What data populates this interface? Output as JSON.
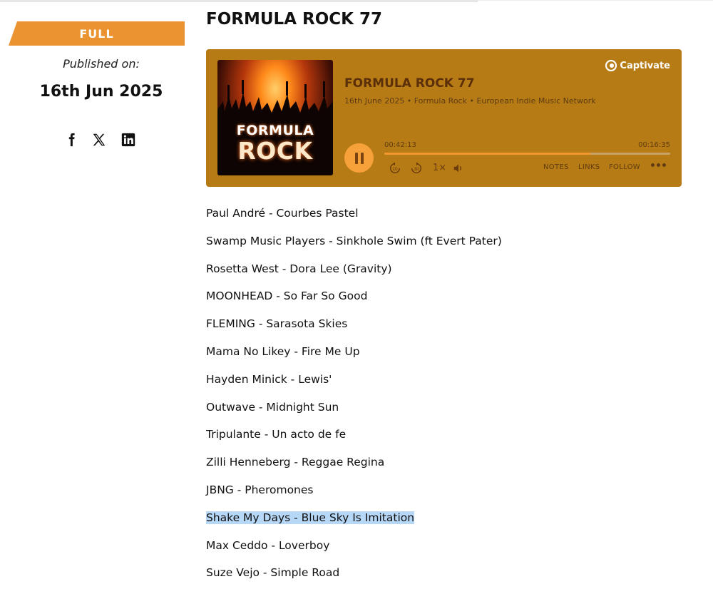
{
  "sidebar": {
    "badge": "FULL",
    "published_label": "Published on:",
    "published_date": "16th Jun 2025",
    "social": [
      "facebook-icon",
      "x-icon",
      "linkedin-icon"
    ]
  },
  "main": {
    "title": "FORMULA ROCK 77"
  },
  "player": {
    "brand": "Captivate",
    "cover_line1": "FORMULA",
    "cover_line2": "ROCK",
    "episode_title": "FORMULA ROCK 77",
    "episode_meta": "16th June 2025 • Formula Rock • European Indie Music Network",
    "current_time": "00:42:13",
    "remaining_time": "00:16:35",
    "progress": 0.72,
    "speed": "1×",
    "links": {
      "notes": "NOTES",
      "links": "LINKS",
      "follow": "FOLLOW"
    },
    "colors": {
      "background": "#b77b15",
      "accent": "#f6a13a"
    }
  },
  "tracks": [
    "Paul André - Courbes Pastel",
    "Swamp Music Players - Sinkhole Swim (ft Evert Pater)",
    "Rosetta West - Dora Lee (Gravity)",
    "MOONHEAD - So Far So Good",
    "FLEMING - Sarasota Skies",
    "Mama No Likey - Fire Me Up",
    "Hayden Minick - Lewis'",
    "Outwave - Midnight Sun",
    "Tripulante - Un acto de fe",
    "Zilli Henneberg - Reggae Regina",
    "JBNG - Pheromones",
    "Shake My Days - Blue Sky Is Imitation",
    "Max Ceddo - Loverboy",
    "Suze Vejo - Simple Road"
  ],
  "highlighted_track_index": 11
}
